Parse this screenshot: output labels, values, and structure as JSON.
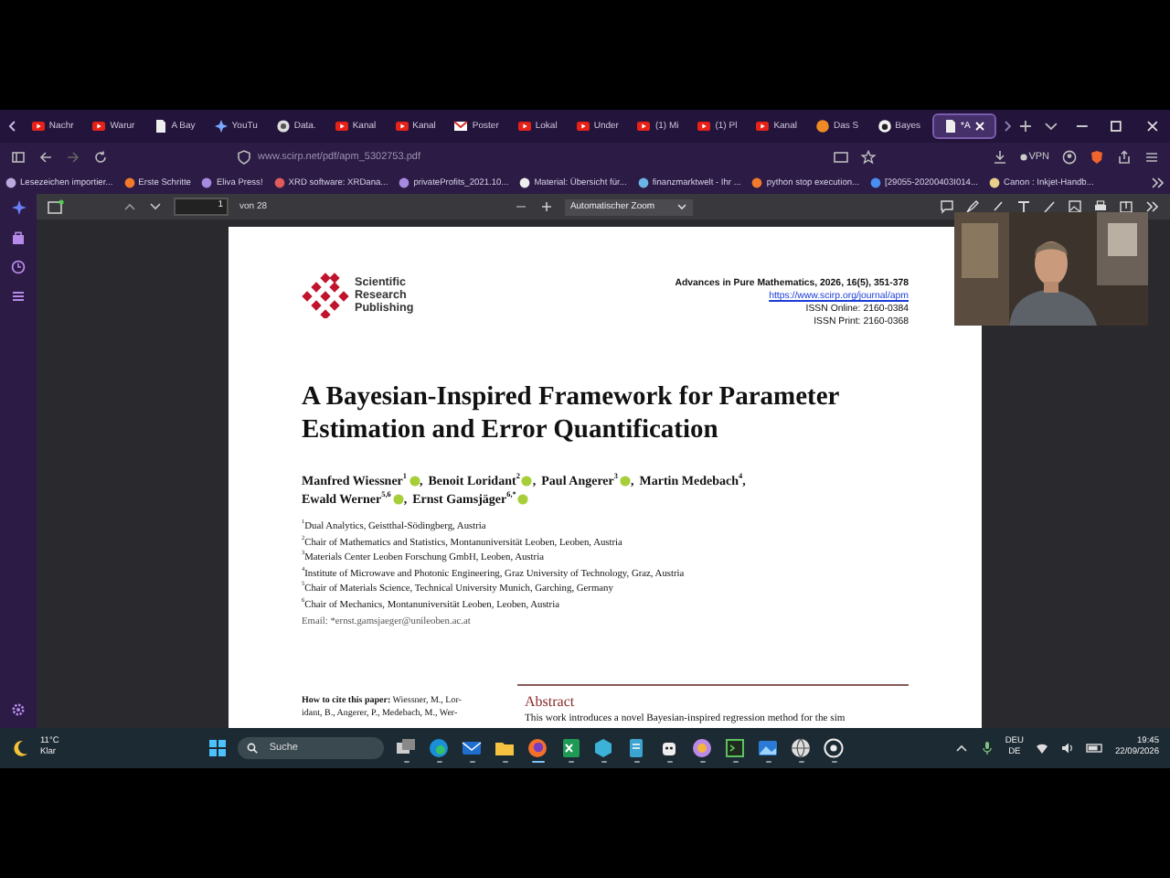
{
  "browser": {
    "tabs": [
      {
        "label": "Nachr",
        "kind": "youtube",
        "selected": false
      },
      {
        "label": "Warur",
        "kind": "youtube",
        "selected": false
      },
      {
        "label": "A Bay",
        "kind": "doc",
        "selected": false
      },
      {
        "label": "YouTu",
        "kind": "spark",
        "selected": false
      },
      {
        "label": "Data.",
        "kind": "ring",
        "selected": false
      },
      {
        "label": "Kanal",
        "kind": "youtube",
        "selected": false
      },
      {
        "label": "Kanal",
        "kind": "youtube",
        "selected": false
      },
      {
        "label": "Poster",
        "kind": "mail",
        "selected": false
      },
      {
        "label": "Lokal",
        "kind": "youtube",
        "selected": false
      },
      {
        "label": "Under",
        "kind": "youtube",
        "selected": false
      },
      {
        "label": "(1) Mi",
        "kind": "youtube",
        "selected": false
      },
      {
        "label": "(1) Pl",
        "kind": "youtube",
        "selected": false
      },
      {
        "label": "Kanal",
        "kind": "youtube",
        "selected": false
      },
      {
        "label": "Das S",
        "kind": "orange",
        "selected": false
      },
      {
        "label": "Bayes",
        "kind": "cat",
        "selected": false
      },
      {
        "label": "*A",
        "kind": "doc",
        "selected": true
      }
    ],
    "url": "www.scirp.net/pdf/apm_5302753.pdf",
    "vpn": "VPN",
    "bookmarks": [
      {
        "label": "Lesezeichen importier..."
      },
      {
        "label": "Erste Schritte"
      },
      {
        "label": "Eliva Press!"
      },
      {
        "label": "XRD software: XRDana..."
      },
      {
        "label": "privateProfits_2021.10..."
      },
      {
        "label": "Material: Übersicht für..."
      },
      {
        "label": "finanzmarktwelt - Ihr ..."
      },
      {
        "label": "python stop execution..."
      },
      {
        "label": "[29055-20200403I014..."
      },
      {
        "label": "Canon : Inkjet-Handb..."
      }
    ]
  },
  "pdf_toolbar": {
    "page": "1",
    "page_count": "von 28",
    "zoom": "Automatischer Zoom"
  },
  "paper": {
    "publisher": "Scientific Research Publishing",
    "journal": "Advances in Pure Mathematics, 2026, 16(5), 351-378",
    "journal_url": "https://www.scirp.org/journal/apm",
    "issn_online": "ISSN Online: 2160-0384",
    "issn_print": "ISSN Print: 2160-0368",
    "title": "A Bayesian-Inspired Framework for Parameter Estimation and Error Quantification",
    "author_lines": [
      [
        {
          "name": "Manfred Wiessner$^{1}$",
          "orcid": true,
          "sep": ","
        },
        {
          "name": "Benoit Loridant$^{2}$",
          "orcid": true,
          "sep": ","
        },
        {
          "name": "Paul Angerer$^{3}$",
          "orcid": true,
          "sep": ","
        },
        {
          "name": "Martin Medebach$^{4}$",
          "orcid": false,
          "sep": ","
        }
      ],
      [
        {
          "name": "Ewald Werner$^{5,6}$",
          "orcid": true,
          "sep": ","
        },
        {
          "name": "Ernst Gamsjäger$^{6,*}$",
          "orcid": true
        }
      ]
    ],
    "affiliations": [
      "$^{1}$Dual Analytics, Geistthal-Södingberg, Austria",
      "$^{2}$Chair of Mathematics and Statistics, Montanuniversität Leoben, Leoben, Austria",
      "$^{3}$Materials Center Leoben Forschung GmbH, Leoben, Austria",
      "$^{4}$Institute of Microwave and Photonic Engineering, Graz University of Technology, Graz, Austria",
      "$^{5}$Chair of Materials Science, Technical University Munich, Garching, Germany",
      "$^{6}$Chair of Mechanics, Montanuniversität Leoben, Leoben, Austria"
    ],
    "email": "Email: *ernst.gamsjaeger@unileoben.ac.at",
    "cite_lines": [
      "**How to cite this paper:** Wiessner, M., Lor-",
      "idant, B., Angerer, P., Medebach, M., Wer-"
    ],
    "abstract_heading": "Abstract",
    "abstract_text": "This work introduces a novel Bayesian-inspired regression method for the sim"
  },
  "taskbar": {
    "temperature": "11°C",
    "weather": "Klar",
    "search": "Suche",
    "apps": [
      {
        "kind": "taskview",
        "selected": false
      },
      {
        "kind": "edge",
        "selected": false
      },
      {
        "kind": "mail",
        "selected": false
      },
      {
        "kind": "folder",
        "selected": false
      },
      {
        "kind": "fox",
        "selected": true
      },
      {
        "kind": "sheet",
        "selected": false
      },
      {
        "kind": "hex",
        "selected": false
      },
      {
        "kind": "notes",
        "selected": false
      },
      {
        "kind": "robot",
        "selected": false
      },
      {
        "kind": "orb",
        "selected": false
      },
      {
        "kind": "terminal",
        "selected": false
      },
      {
        "kind": "photos",
        "selected": false
      },
      {
        "kind": "globe",
        "selected": false
      },
      {
        "kind": "circle",
        "selected": false
      }
    ],
    "language": "DEU",
    "layout": "DE",
    "time": "19:45",
    "date": "22/09/2026"
  }
}
